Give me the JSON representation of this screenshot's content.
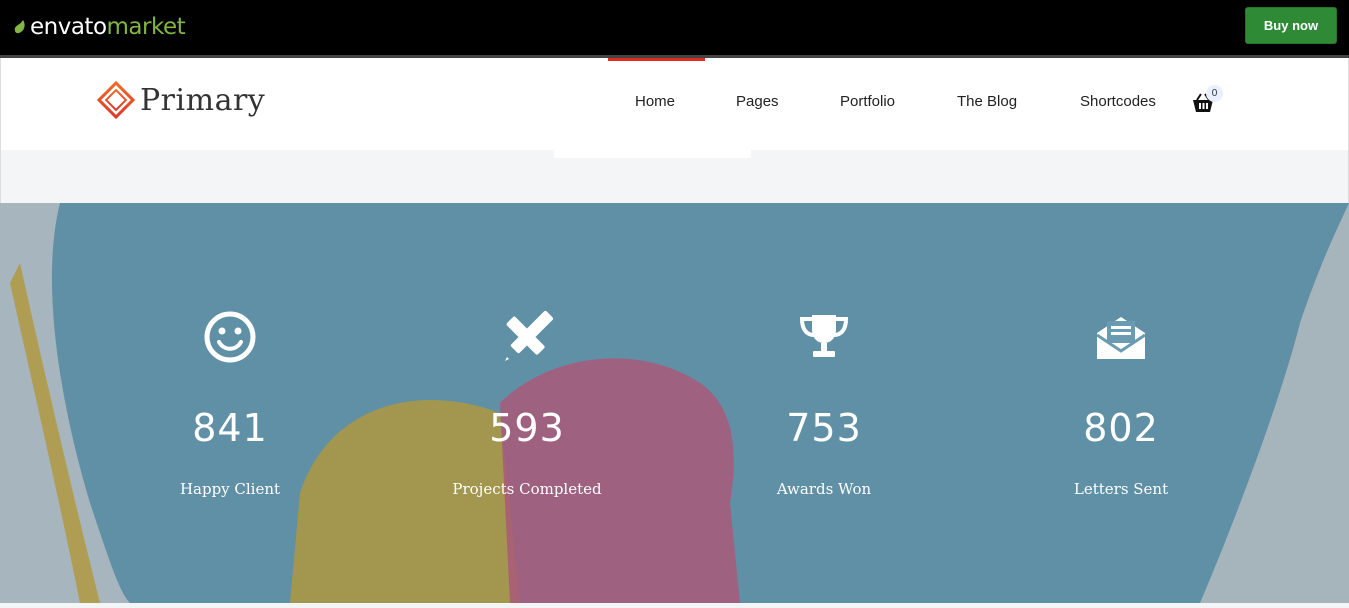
{
  "topbar": {
    "logo_envato": "envato",
    "logo_market": "market",
    "buy_now": "Buy now",
    "colors": {
      "background": "#000000",
      "market": "#82b541",
      "buy_button": "#2f8a36"
    }
  },
  "header": {
    "brand": "Primary",
    "nav": [
      "Home",
      "Pages",
      "Portfolio",
      "The Blog",
      "Shortcodes"
    ],
    "active_item": "Home",
    "cart_icon": "basket-icon",
    "cart_count": "0",
    "accent": "#e02b20"
  },
  "counters": [
    {
      "icon": "smile-icon",
      "value": "841",
      "label": "Happy Client"
    },
    {
      "icon": "pencil-ruler-icon",
      "value": "593",
      "label": "Projects Completed"
    },
    {
      "icon": "trophy-icon",
      "value": "753",
      "label": "Awards Won"
    },
    {
      "icon": "envelope-open-icon",
      "value": "802",
      "label": "Letters Sent"
    }
  ]
}
